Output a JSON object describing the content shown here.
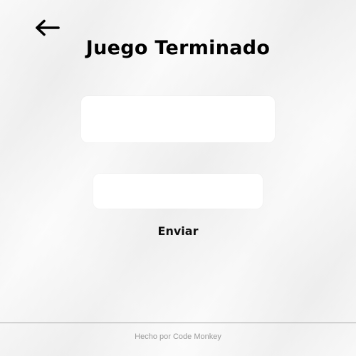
{
  "header": {
    "back_icon": "arrow-left-icon",
    "title": "Juego Terminado"
  },
  "form": {
    "field_1": {
      "value": "",
      "placeholder": ""
    },
    "field_2": {
      "value": "",
      "placeholder": ""
    },
    "submit_label": "Enviar"
  },
  "footer": {
    "credit": "Hecho por Code Monkey"
  },
  "colors": {
    "background": "#f3f3f3",
    "field_background": "#ffffff",
    "text": "#000000",
    "footer_text": "#9a9a9a",
    "divider": "#a8a8a8"
  }
}
